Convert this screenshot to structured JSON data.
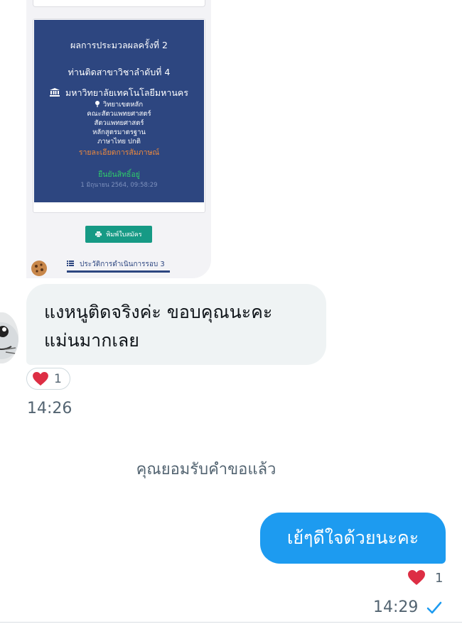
{
  "screenshot": {
    "result_title": "ผลการประมวลผลครั้งที่ 2",
    "rank_text": "ท่านติดสาขาวิชาลำดับที่ 4",
    "university": "มหาวิทยาลัยเทคโนโลยีมหานคร",
    "campus": "วิทยาเขตหลัก",
    "faculty": "คณะสัตวแพทยศาสตร์",
    "major": "สัตวแพทยศาสตร์",
    "curriculum": "หลักสูตรมาตรฐาน",
    "language": "ภาษาไทย ปกติ",
    "interview_details": "รายละเอียดการสัมภาษณ์",
    "confirm_status": "ยืนยันสิทธิ์อยู่",
    "confirm_date": "1 มิถุนายน 2564, 09:58:29",
    "print_button": "พิมพ์ใบสมัคร",
    "history_label": "ประวัติการดำเนินการรอบ 3"
  },
  "incoming": {
    "line1": "แงหนูติดจริงค่ะ ขอบคุณนะคะ",
    "line2": "แม่นมากเลย",
    "reaction_count": "1",
    "time": "14:26"
  },
  "system_message": "คุณยอมรับคำขอแล้ว",
  "outgoing": {
    "text": "เย้ๆดีใจด้วยนะคะ",
    "reaction_count": "1",
    "time": "14:29"
  },
  "colors": {
    "outgoing_bubble": "#1d9bf0",
    "incoming_bubble": "#eff3f4",
    "heart": "#e0245e",
    "result_panel": "#2d4680"
  },
  "icons": [
    "bank-icon",
    "pin-icon",
    "printer-icon",
    "list-icon",
    "heart-icon",
    "check-icon",
    "avatar-icon",
    "cookie-icon"
  ]
}
